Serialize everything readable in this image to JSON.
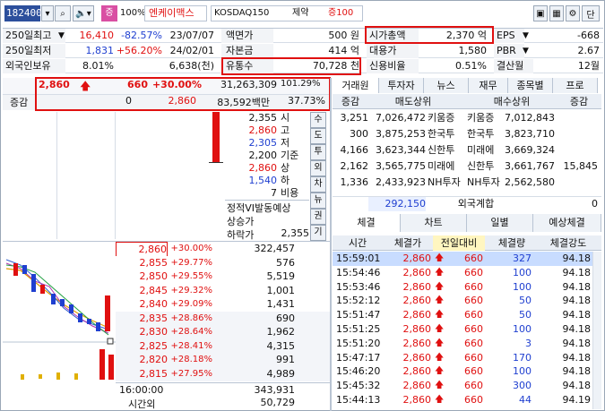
{
  "toolbar": {
    "code": "182400",
    "percent": "100%",
    "stock_name": "엔케이맥스",
    "market": "KOSDAQ150",
    "sector": "제약",
    "margin": "증100",
    "dan_label": "단"
  },
  "info": {
    "rows": [
      {
        "label": "250일최고",
        "v1": "16,410",
        "v2": "-82.57%",
        "v3": "23/07/07",
        "l2": "액면가",
        "v4": "500 원",
        "l3": "시가총액",
        "v5": "2,370 억",
        "l4": "EPS",
        "v6": "-668"
      },
      {
        "label": "250일최저",
        "v1": "1,831",
        "v2": "+56.20%",
        "v3": "24/02/01",
        "l2": "자본금",
        "v4": "414 억",
        "l3": "대용가",
        "v5": "1,580",
        "l4": "PBR",
        "v6": "2.67"
      },
      {
        "label": "외국인보유",
        "v1": "8.01%",
        "v2": "",
        "v3": "6,638(천)",
        "l2": "유통수",
        "v4": "70,728 천",
        "l3": "신용비율",
        "v5": "0.51%",
        "l4": "결산월",
        "v6": "12월"
      }
    ]
  },
  "price": {
    "current": "2,860",
    "change": "660",
    "rate": "+30.00%",
    "volume": "31,263,309",
    "vol_ratio": "101.29%",
    "change_label": "증감",
    "change_qty": "0",
    "current2": "2,860",
    "amount": "83,592백만",
    "amount_rate": "37.73%"
  },
  "summary": [
    {
      "v": "2,355",
      "k": "시"
    },
    {
      "v": "2,860",
      "k": "고"
    },
    {
      "v": "2,305",
      "k": "저"
    },
    {
      "v": "2,200",
      "k": "기준"
    },
    {
      "v": "2,860",
      "k": "상"
    },
    {
      "v": "1,540",
      "k": "하"
    },
    {
      "v": "7",
      "k": "비용"
    }
  ],
  "vi": {
    "title": "정적VI발동예상",
    "up": "상승가",
    "down": "하락가",
    "down_val": "2,355"
  },
  "side_tabs": [
    "수",
    "도",
    "투",
    "외",
    "차",
    "뉴",
    "권",
    "기"
  ],
  "orderbook": [
    {
      "price": "2,860",
      "rate": "+30.00%",
      "qty": "322,457"
    },
    {
      "price": "2,855",
      "rate": "+29.77%",
      "qty": "576"
    },
    {
      "price": "2,850",
      "rate": "+29.55%",
      "qty": "5,519"
    },
    {
      "price": "2,845",
      "rate": "+29.32%",
      "qty": "1,001"
    },
    {
      "price": "2,840",
      "rate": "+29.09%",
      "qty": "1,431"
    },
    {
      "price": "2,835",
      "rate": "+28.86%",
      "qty": "690"
    },
    {
      "price": "2,830",
      "rate": "+28.64%",
      "qty": "1,962"
    },
    {
      "price": "2,825",
      "rate": "+28.41%",
      "qty": "4,315"
    },
    {
      "price": "2,820",
      "rate": "+28.18%",
      "qty": "991"
    },
    {
      "price": "2,815",
      "rate": "+27.95%",
      "qty": "4,989"
    }
  ],
  "orderbook_total": {
    "time": "16:00:00",
    "qty": "343,931",
    "label": "시간외",
    "qty2": "50,729"
  },
  "broker": {
    "tabs": [
      "거래원",
      "투자자",
      "뉴스",
      "재무",
      "종목별",
      "프로"
    ],
    "headers": [
      "증감",
      "매도상위",
      "매수상위",
      "증감"
    ],
    "rows": [
      {
        "inc": "3,251",
        "sell_qty": "7,026,472",
        "sell": "키움증",
        "buy": "키움증",
        "buy_qty": "7,012,843",
        "inc2": ""
      },
      {
        "inc": "300",
        "sell_qty": "3,875,253",
        "sell": "한국투",
        "buy": "한국투",
        "buy_qty": "3,823,710",
        "inc2": ""
      },
      {
        "inc": "4,166",
        "sell_qty": "3,623,344",
        "sell": "신한투",
        "buy": "미래에",
        "buy_qty": "3,669,324",
        "inc2": ""
      },
      {
        "inc": "2,162",
        "sell_qty": "3,565,775",
        "sell": "미래에",
        "buy": "신한투",
        "buy_qty": "3,661,767",
        "inc2": "15,845"
      },
      {
        "inc": "1,336",
        "sell_qty": "2,433,923",
        "sell": "NH투자",
        "buy": "NH투자",
        "buy_qty": "2,562,580",
        "inc2": ""
      }
    ],
    "foreign_qty": "292,150",
    "foreign_label": "외국계합",
    "foreign_val": "0"
  },
  "ticks": {
    "tabs": [
      "체결",
      "차트",
      "일별",
      "예상체결"
    ],
    "headers": [
      "시간",
      "체결가",
      "전일대비",
      "체결량",
      "체결강도"
    ],
    "rows": [
      {
        "t": "15:59:01",
        "p": "2,860",
        "d": "660",
        "q": "327",
        "s": "94.18"
      },
      {
        "t": "15:54:46",
        "p": "2,860",
        "d": "660",
        "q": "100",
        "s": "94.18"
      },
      {
        "t": "15:53:46",
        "p": "2,860",
        "d": "660",
        "q": "100",
        "s": "94.18"
      },
      {
        "t": "15:52:12",
        "p": "2,860",
        "d": "660",
        "q": "50",
        "s": "94.18"
      },
      {
        "t": "15:51:47",
        "p": "2,860",
        "d": "660",
        "q": "50",
        "s": "94.18"
      },
      {
        "t": "15:51:25",
        "p": "2,860",
        "d": "660",
        "q": "100",
        "s": "94.18"
      },
      {
        "t": "15:51:20",
        "p": "2,860",
        "d": "660",
        "q": "3",
        "s": "94.18"
      },
      {
        "t": "15:47:17",
        "p": "2,860",
        "d": "660",
        "q": "170",
        "s": "94.18"
      },
      {
        "t": "15:46:20",
        "p": "2,860",
        "d": "660",
        "q": "100",
        "s": "94.18"
      },
      {
        "t": "15:45:32",
        "p": "2,860",
        "d": "660",
        "q": "300",
        "s": "94.18"
      },
      {
        "t": "15:44:13",
        "p": "2,860",
        "d": "660",
        "q": "44",
        "s": "94.19"
      }
    ]
  },
  "colors": {
    "up": "#e01010",
    "down": "#1f3fd0",
    "highlight_row": "#c8dcff"
  }
}
